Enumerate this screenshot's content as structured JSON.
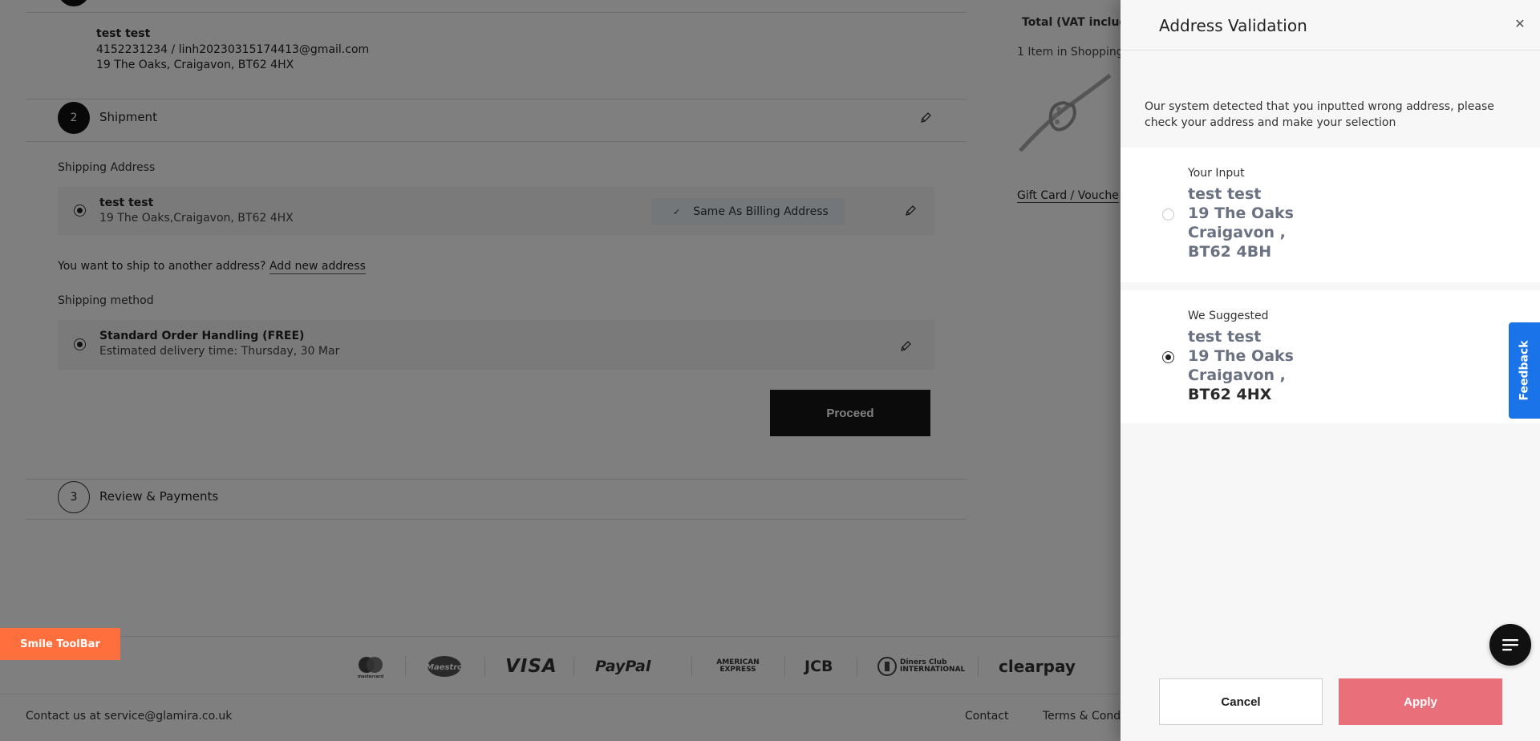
{
  "billing": {
    "name": "test test",
    "contact": "4152231234 / linh20230315174413@gmail.com",
    "address": "19 The Oaks, Craigavon, BT62 4HX"
  },
  "steps": {
    "shipment": {
      "number": "2",
      "title": "Shipment"
    },
    "review": {
      "number": "3",
      "title": "Review & Payments"
    }
  },
  "shipping_address": {
    "section_label": "Shipping Address",
    "name": "test test",
    "address": "19 The Oaks,Craigavon, BT62 4HX",
    "badge": "Same As Billing Address",
    "another_prompt": "You want to ship to another address?",
    "add_new_link": "Add new address"
  },
  "shipping_method": {
    "section_label": "Shipping method",
    "name": "Standard Order Handling (FREE)",
    "estimate": "Estimated delivery time: Thursday, 30 Mar"
  },
  "proceed_label": "Proceed",
  "summary": {
    "total_label": "Total (VAT includ",
    "items_label": "1 Item in Shopping",
    "gift_card": "Gift Card / Vouche"
  },
  "footer": {
    "payment_logos": [
      "mastercard",
      "Maestro",
      "VISA",
      "PayPal",
      "AMERICAN EXPRESS",
      "JCB",
      "Diners Club INTERNATIONAL",
      "clearpay"
    ],
    "contact": "Contact us at service@glamira.co.uk",
    "links": [
      "Contact",
      "Terms & Cond"
    ]
  },
  "smile_toolbar": "Smile ToolBar",
  "feedback_label": "Feedback",
  "modal": {
    "title": "Address Validation",
    "message": "Our system detected that you inputted wrong address, please check your address and make your selection",
    "options": [
      {
        "label": "Your Input",
        "name": "test test",
        "street": "19 The Oaks",
        "city": "Craigavon ,",
        "postcode": "BT62 4BH",
        "selected": false
      },
      {
        "label": "We Suggested",
        "name": "test test",
        "street": "19 The Oaks",
        "city": "Craigavon ,",
        "postcode": "BT62 4HX",
        "selected": true
      }
    ],
    "cancel_label": "Cancel",
    "apply_label": "Apply"
  }
}
